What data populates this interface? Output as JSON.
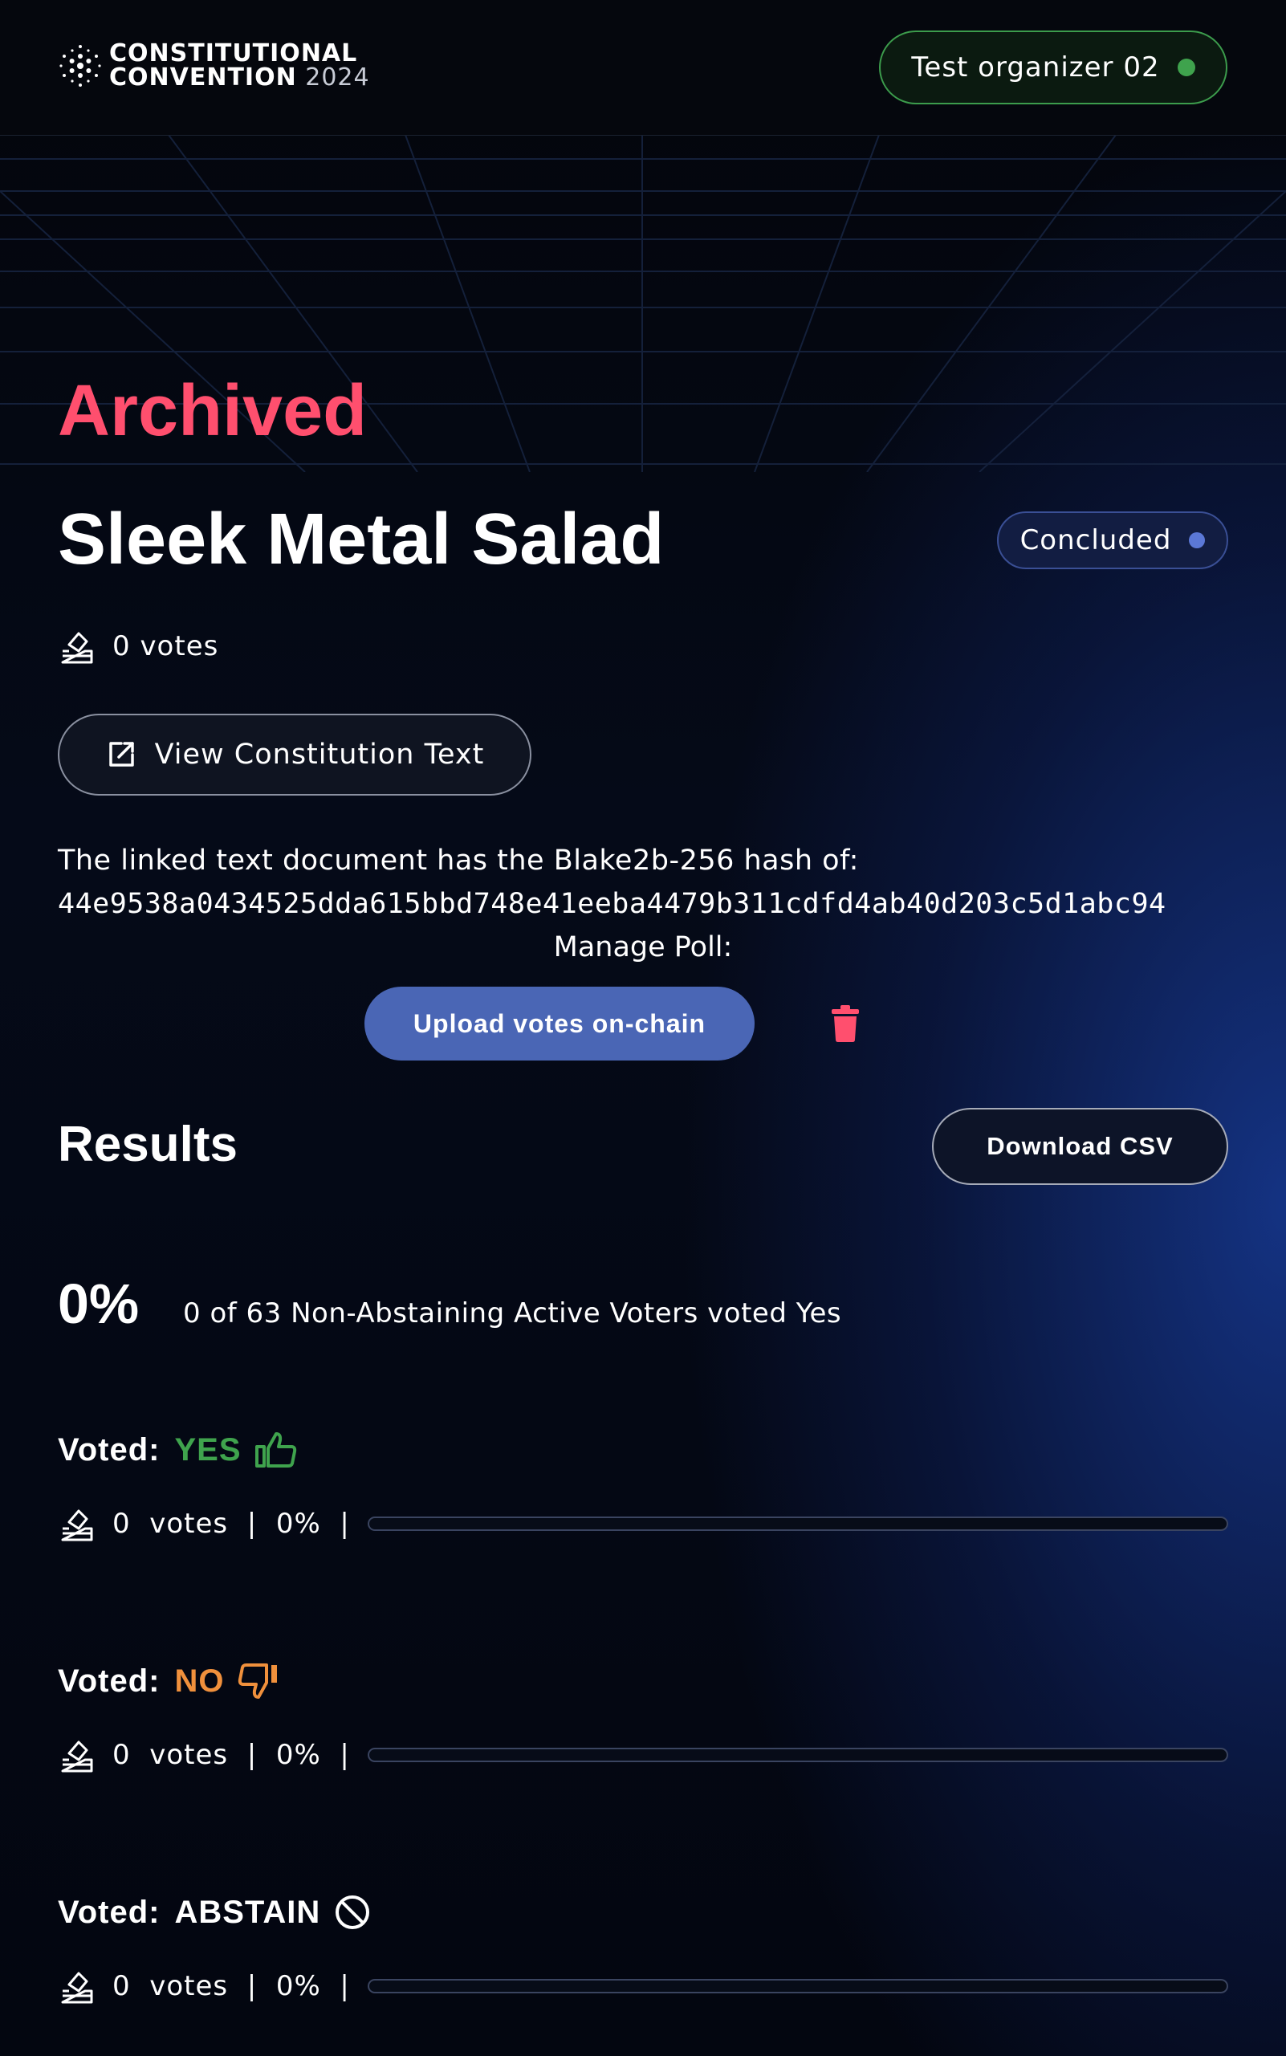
{
  "header": {
    "logo": {
      "line1": "CONSTITUTIONAL",
      "line2_main": "CONVENTION",
      "line2_year": "2024"
    },
    "user": {
      "name": "Test organizer 02",
      "status_color": "#3fa34d"
    }
  },
  "poll": {
    "archived_label": "Archived",
    "title": "Sleek Metal Salad",
    "status": "Concluded",
    "votes_text": "0 votes",
    "view_button": "View Constitution Text",
    "hash_label": "The linked text document has the Blake2b-256 hash of:",
    "hash_value": "44e9538a0434525dda615bbd748e41eeba4479b311cdfd4ab40d203c5d1abc94",
    "manage_label": "Manage Poll:",
    "upload_button": "Upload votes on-chain"
  },
  "results": {
    "title": "Results",
    "download_button": "Download CSV",
    "percent": "0%",
    "summary": "0 of 63 Non-Abstaining Active Voters voted Yes",
    "options": [
      {
        "label": "Voted:",
        "value": "YES",
        "color": "#3fa34d",
        "icon": "thumbs-up-icon",
        "stats": "0  votes  |  0%  |",
        "fraction": 0
      },
      {
        "label": "Voted:",
        "value": "NO",
        "color": "#f0903c",
        "icon": "thumbs-down-icon",
        "stats": "0  votes  |  0%  |",
        "fraction": 0
      },
      {
        "label": "Voted:",
        "value": "ABSTAIN",
        "color": "#ffffff",
        "icon": "prohibited-icon",
        "stats": "0  votes  |  0%  |",
        "fraction": 0
      }
    ]
  },
  "colors": {
    "archived": "#ff4f6e",
    "accent": "#4a66b5",
    "delete": "#ff4f6e"
  }
}
